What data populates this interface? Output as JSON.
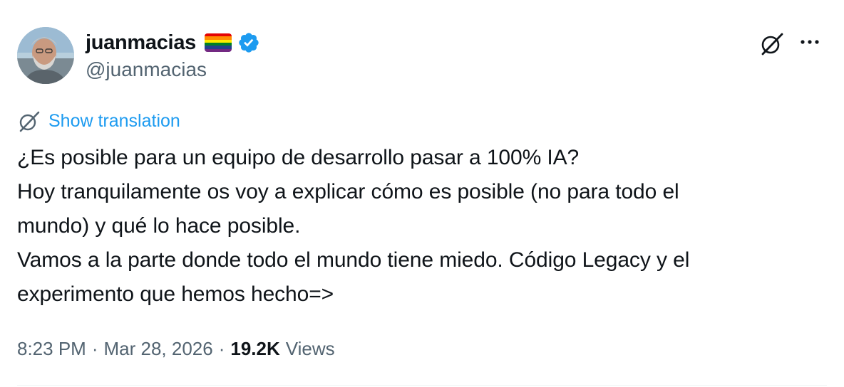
{
  "author": {
    "display_name": "juanmacias",
    "handle": "@juanmacias",
    "flag_icon": "rainbow-flag-icon",
    "flag_colors": [
      "#e40303",
      "#ff8c00",
      "#ffed00",
      "#008026",
      "#24408e",
      "#732982"
    ],
    "verified_icon": "verified-badge-icon",
    "verified_color": "#1d9bf0"
  },
  "actions": {
    "grok_icon": "grok-icon",
    "more_icon": "more-dots-icon"
  },
  "translation": {
    "icon": "grok-icon",
    "label": "Show translation",
    "color": "#1d9bf0"
  },
  "body_lines": [
    "¿Es posible para un equipo de desarrollo pasar a 100% IA?",
    "Hoy tranquilamente os voy a explicar cómo es posible (no para todo el",
    "mundo) y qué lo hace posible.",
    "Vamos a la parte donde todo el mundo tiene miedo. Código Legacy y el",
    "experimento que hemos hecho=>"
  ],
  "meta": {
    "time": "8:23 PM",
    "separator": "·",
    "date": "Mar 28, 2026",
    "views_count": "19.2K",
    "views_label": "Views"
  },
  "colors": {
    "text_primary": "#0f1419",
    "text_secondary": "#536471",
    "accent": "#1d9bf0",
    "divider": "#eff3f4"
  }
}
